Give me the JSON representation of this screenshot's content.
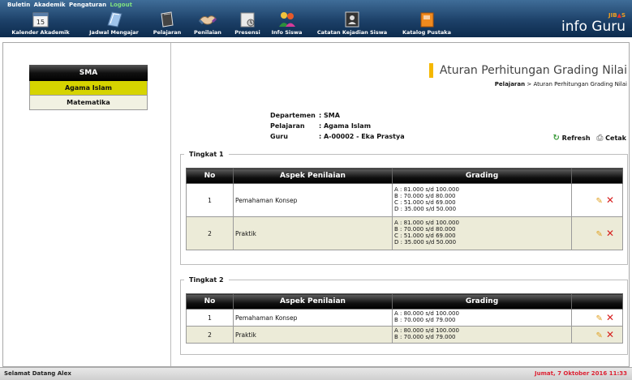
{
  "topmenu": {
    "buletin": "Buletin",
    "akademik": "Akademik",
    "pengaturan": "Pengaturan",
    "logout": "Logout"
  },
  "nav": [
    {
      "label": "Kalender Akademik",
      "icon": "calendar-icon",
      "number": "15"
    },
    {
      "label": "Jadwal Mengajar",
      "icon": "schedule-icon"
    },
    {
      "label": "Pelajaran",
      "icon": "book-icon"
    },
    {
      "label": "Penilaian",
      "icon": "handshake-icon"
    },
    {
      "label": "Presensi",
      "icon": "attendance-icon"
    },
    {
      "label": "Info Siswa",
      "icon": "students-icon"
    },
    {
      "label": "Catatan Kejadian Siswa",
      "icon": "notes-icon"
    },
    {
      "label": "Katalog Pustaka",
      "icon": "library-icon"
    }
  ],
  "logo": {
    "jib_left": "JIB",
    "jib_dot": "▲",
    "jib_right": "S",
    "text": "info Guru"
  },
  "sidebar": {
    "header": "SMA",
    "items": [
      {
        "label": "Agama Islam"
      },
      {
        "label": "Matematika"
      }
    ]
  },
  "page": {
    "title": "Aturan Perhitungan Grading Nilai",
    "breadcrumb_root": "Pelajaran",
    "breadcrumb_sep": ">",
    "breadcrumb_current": "Aturan Perhitungan Grading Nilai"
  },
  "info": {
    "departemen_label": "Departemen",
    "departemen_value": ": SMA",
    "pelajaran_label": "Pelajaran",
    "pelajaran_value": ": Agama Islam",
    "guru_label": "Guru",
    "guru_value": ": A-00002 - Eka Prastya"
  },
  "actions": {
    "refresh": "Refresh",
    "cetak": "Cetak"
  },
  "columns": {
    "no": "No",
    "aspek": "Aspek Penilaian",
    "grading": "Grading"
  },
  "tingkat": [
    {
      "title": "Tingkat 1",
      "rows": [
        {
          "no": "1",
          "aspek": "Pemahaman Konsep",
          "grading": [
            "A : 81.000 s/d 100.000",
            "B : 70.000 s/d 80.000",
            "C : 51.000 s/d 69.000",
            "D : 35.000 s/d 50.000"
          ]
        },
        {
          "no": "2",
          "aspek": "Praktik",
          "grading": [
            "A : 81.000 s/d 100.000",
            "B : 70.000 s/d 80.000",
            "C : 51.000 s/d 69.000",
            "D : 35.000 s/d 50.000"
          ]
        }
      ]
    },
    {
      "title": "Tingkat 2",
      "rows": [
        {
          "no": "1",
          "aspek": "Pemahaman Konsep",
          "grading": [
            "A : 80.000 s/d 100.000",
            "B : 70.000 s/d 79.000"
          ]
        },
        {
          "no": "2",
          "aspek": "Praktik",
          "grading": [
            "A : 80.000 s/d 100.000",
            "B : 70.000 s/d 79.000"
          ]
        }
      ]
    }
  ],
  "status": {
    "left": "Selamat Datang Alex",
    "right": "Jumat, 7 Oktober 2016 11:33"
  }
}
